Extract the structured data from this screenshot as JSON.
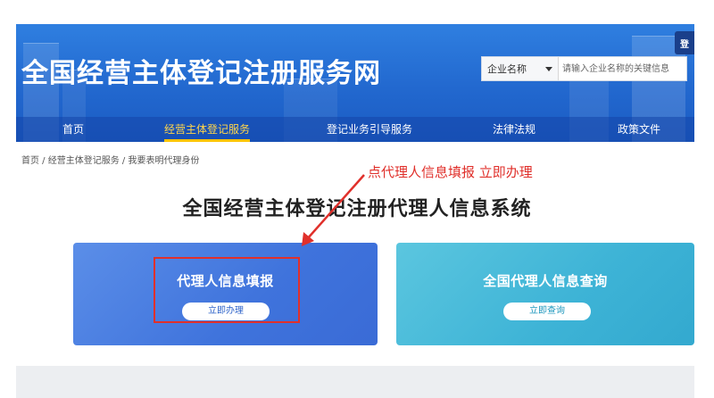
{
  "header": {
    "site_title": "全国经营主体登记注册服务网",
    "login_tab": "登",
    "search": {
      "select_value": "企业名称",
      "placeholder": "请输入企业名称的关键信息"
    },
    "nav": [
      {
        "label": "首页"
      },
      {
        "label": "经营主体登记服务",
        "active": true
      },
      {
        "label": "登记业务引导服务"
      },
      {
        "label": "法律法规"
      },
      {
        "label": "政策文件"
      }
    ]
  },
  "breadcrumb": "首页 / 经营主体登记服务 / 我要表明代理身份",
  "annotation": "点代理人信息填报 立即办理",
  "page_title": "全国经营主体登记注册代理人信息系统",
  "cards": [
    {
      "title": "代理人信息填报",
      "button": "立即办理"
    },
    {
      "title": "全国代理人信息查询",
      "button": "立即查询"
    }
  ],
  "colors": {
    "header_blue": "#2268cf",
    "nav_active": "#ffc400",
    "annotation_red": "#e0302b",
    "card_left": "#3f73dc",
    "card_right": "#3db3d6"
  }
}
